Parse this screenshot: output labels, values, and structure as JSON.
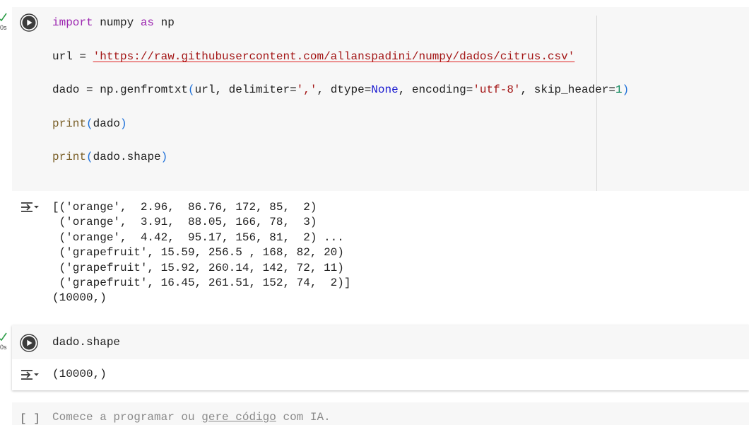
{
  "cells": [
    {
      "status_time": "0s",
      "code": {
        "line1": {
          "kw_import": "import",
          "mod": " numpy ",
          "kw_as": "as",
          "alias": " np"
        },
        "line2": {
          "pre": "url = ",
          "url_string": "'https://raw.githubusercontent.com/allanspadini/numpy/dados/citrus.csv'"
        },
        "line3": {
          "pre": "dado = np.genfromtxt",
          "open": "(",
          "args_a": "url, delimiter=",
          "delim": "','",
          "args_b": ", dtype=",
          "none": "None",
          "args_c": ", encoding=",
          "enc": "'utf-8'",
          "args_d": ", skip_header=",
          "skip": "1",
          "close": ")"
        },
        "line4": {
          "fn": "print",
          "open": "(",
          "arg": "dado",
          "close": ")"
        },
        "line5": {
          "fn": "print",
          "open": "(",
          "arg": "dado.shape",
          "close": ")"
        }
      },
      "output": "[('orange',  2.96,  86.76, 172, 85,  2)\n ('orange',  3.91,  88.05, 166, 78,  3)\n ('orange',  4.42,  95.17, 156, 81,  2) ...\n ('grapefruit', 15.59, 256.5 , 168, 82, 20)\n ('grapefruit', 15.92, 260.14, 142, 72, 11)\n ('grapefruit', 16.45, 261.51, 152, 74,  2)]\n(10000,)"
    },
    {
      "status_time": "0s",
      "code_line": "dado.shape",
      "output": "(10000,)"
    }
  ],
  "empty_cell": {
    "brackets": "[ ]",
    "placeholder_a": "Comece a programar ou ",
    "placeholder_link": "gere código",
    "placeholder_b": " com IA."
  },
  "colors": {
    "keyword": "#9c27b0",
    "string": "#a31515",
    "constant": "#1a1ad0",
    "number": "#098658",
    "function": "#795e26",
    "paren": "#1a6ed8",
    "check": "#2e9e49"
  },
  "icons": {
    "run": "play-circle-icon",
    "output_menu": "output-menu-icon",
    "status": "check-icon"
  }
}
